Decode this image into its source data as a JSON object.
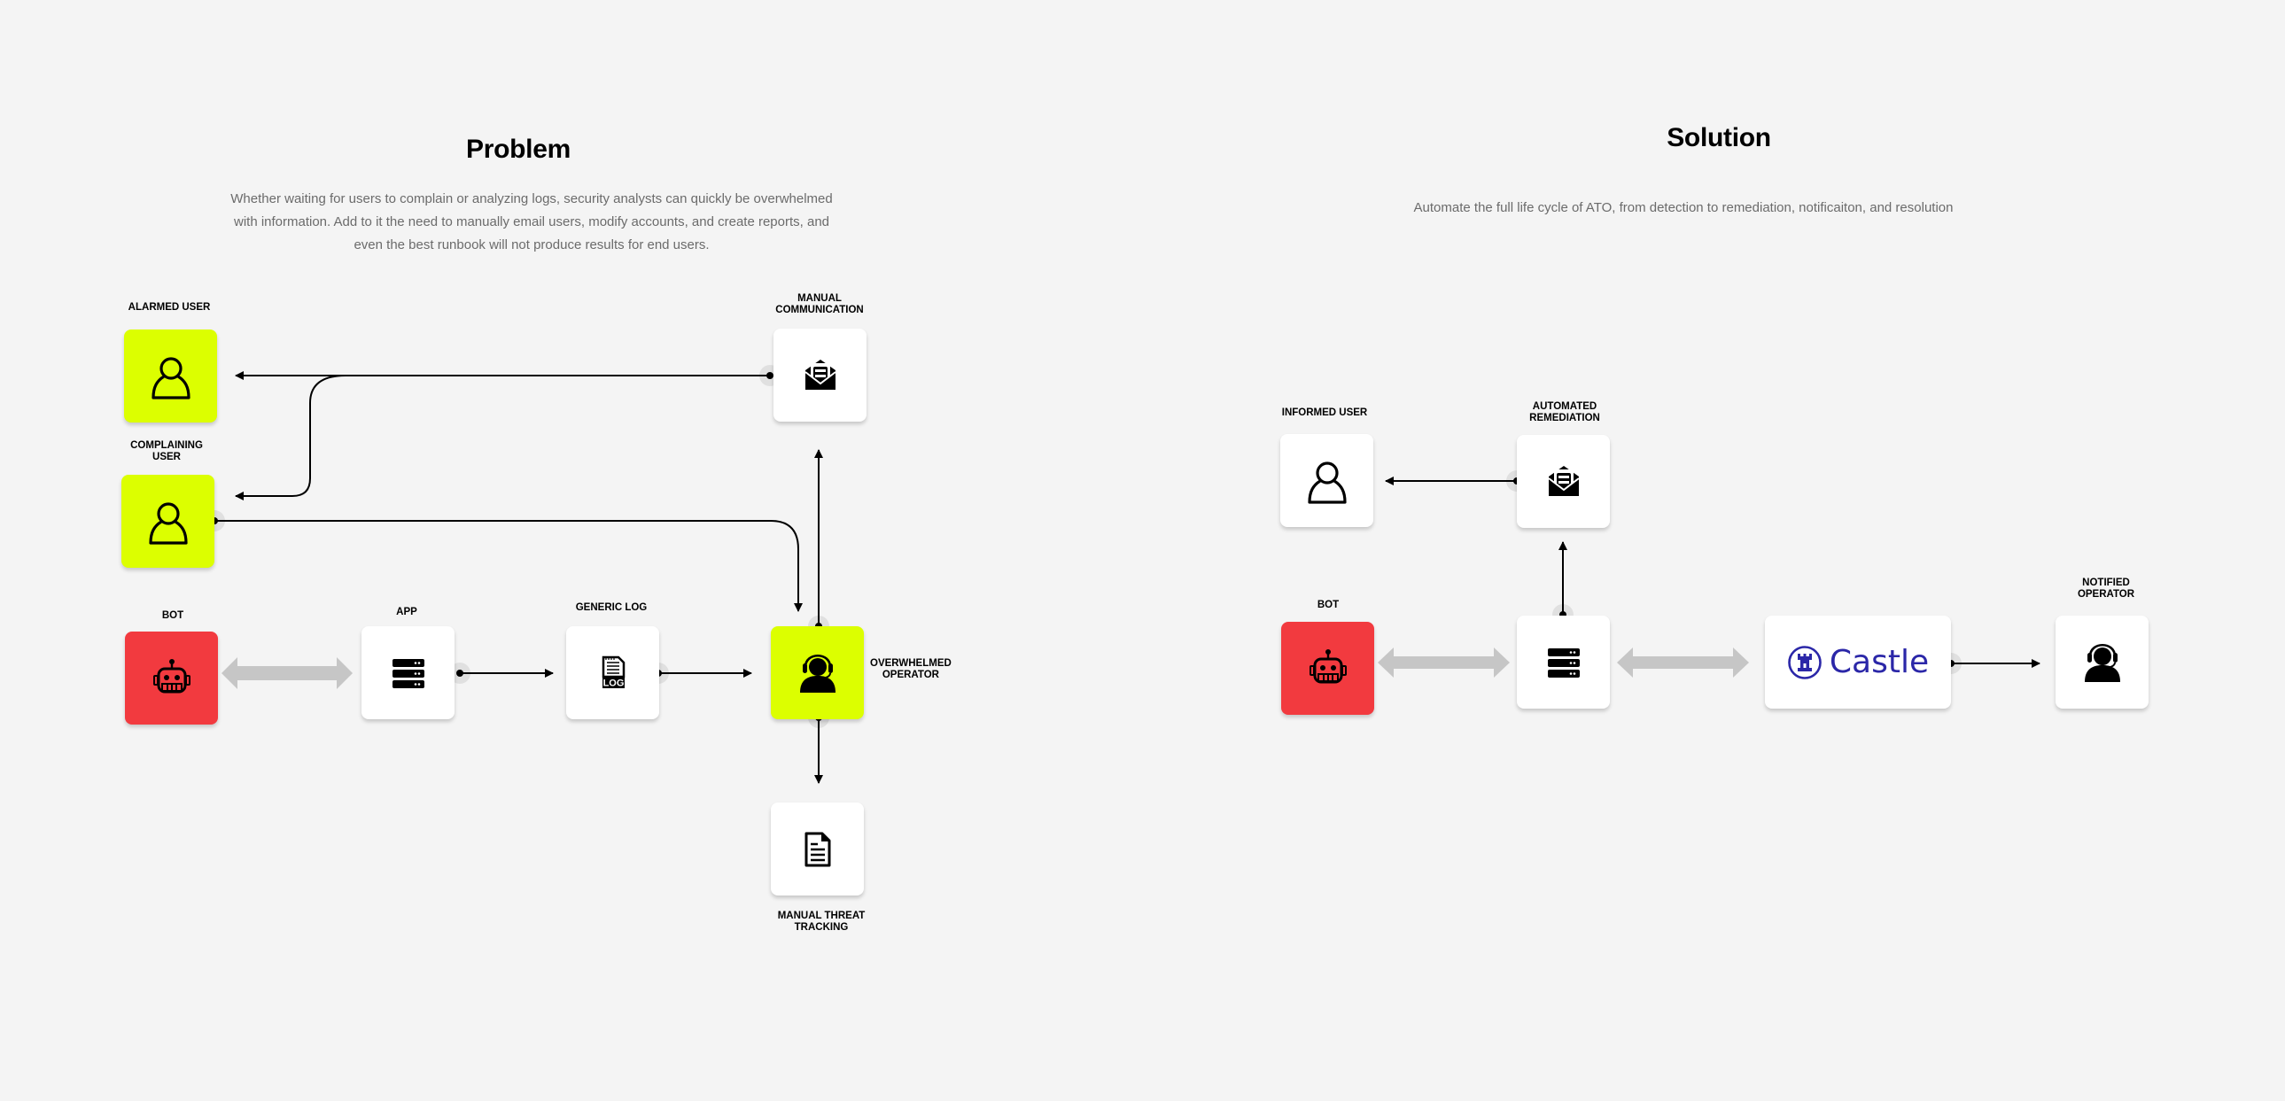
{
  "problem": {
    "title": "Problem",
    "description": [
      "Whether waiting for users to complain or analyzing logs, security analysts can quickly be overwhelmed",
      "with information. Add to it the need to manually email users, modify accounts, and create reports, and",
      "even the best runbook will not produce results for end users."
    ],
    "nodes": {
      "alarmed_user": {
        "label": "ALARMED USER",
        "icon": "user-outline-icon"
      },
      "complaining_user": {
        "label_line1": "COMPLAINING",
        "label_line2": "USER",
        "icon": "user-outline-icon"
      },
      "manual_communication": {
        "label_line1": "MANUAL",
        "label_line2": "COMMUNICATION",
        "icon": "open-envelope-icon"
      },
      "bot": {
        "label": "BOT",
        "icon": "robot-icon"
      },
      "app": {
        "label": "APP",
        "icon": "server-icon"
      },
      "generic_log": {
        "label": "GENERIC LOG",
        "icon": "log-file-icon"
      },
      "overwhelmed_operator": {
        "label_line1": "OVERWHELMED",
        "label_line2": "OPERATOR",
        "icon": "headset-operator-icon"
      },
      "manual_threat_tracking": {
        "label_line1": "MANUAL THREAT",
        "label_line2": "TRACKING",
        "icon": "document-icon"
      }
    }
  },
  "solution": {
    "title": "Solution",
    "description": "Automate the full life cycle of ATO, from detection to remediation, notificaiton, and resolution",
    "nodes": {
      "informed_user": {
        "label": "INFORMED USER",
        "icon": "user-outline-icon"
      },
      "automated_remediation": {
        "label_line1": "AUTOMATED",
        "label_line2": "REMEDIATION",
        "icon": "open-envelope-icon"
      },
      "bot": {
        "label": "BOT",
        "icon": "robot-icon"
      },
      "app": {
        "label": "",
        "icon": "server-icon"
      },
      "castle": {
        "brand": "Castle",
        "icon": "castle-rook-icon"
      },
      "notified_operator": {
        "label_line1": "NOTIFIED",
        "label_line2": "OPERATOR",
        "icon": "headset-operator-icon"
      }
    }
  },
  "colors": {
    "background": "#f4f4f4",
    "highlight_lime": "#dcff00",
    "bot_red": "#f23a3f",
    "castle_brand": "#2b27a8",
    "wire": "#000000",
    "bidirectional_arrow": "#c6c6c6"
  }
}
